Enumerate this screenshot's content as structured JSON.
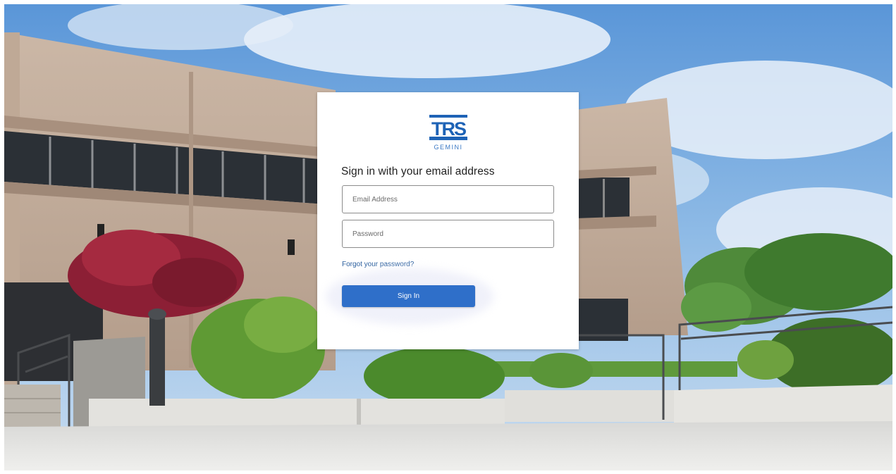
{
  "login": {
    "logo_text": "TRS",
    "logo_subtext": "GEMINI",
    "heading": "Sign in with your email address",
    "email_placeholder": "Email Address",
    "password_placeholder": "Password",
    "forgot_link": "Forgot your password?",
    "signin_button": "Sign In"
  },
  "colors": {
    "button": "#2f6fc9",
    "link": "#2b5f9e",
    "logo": "#1e63b6"
  }
}
